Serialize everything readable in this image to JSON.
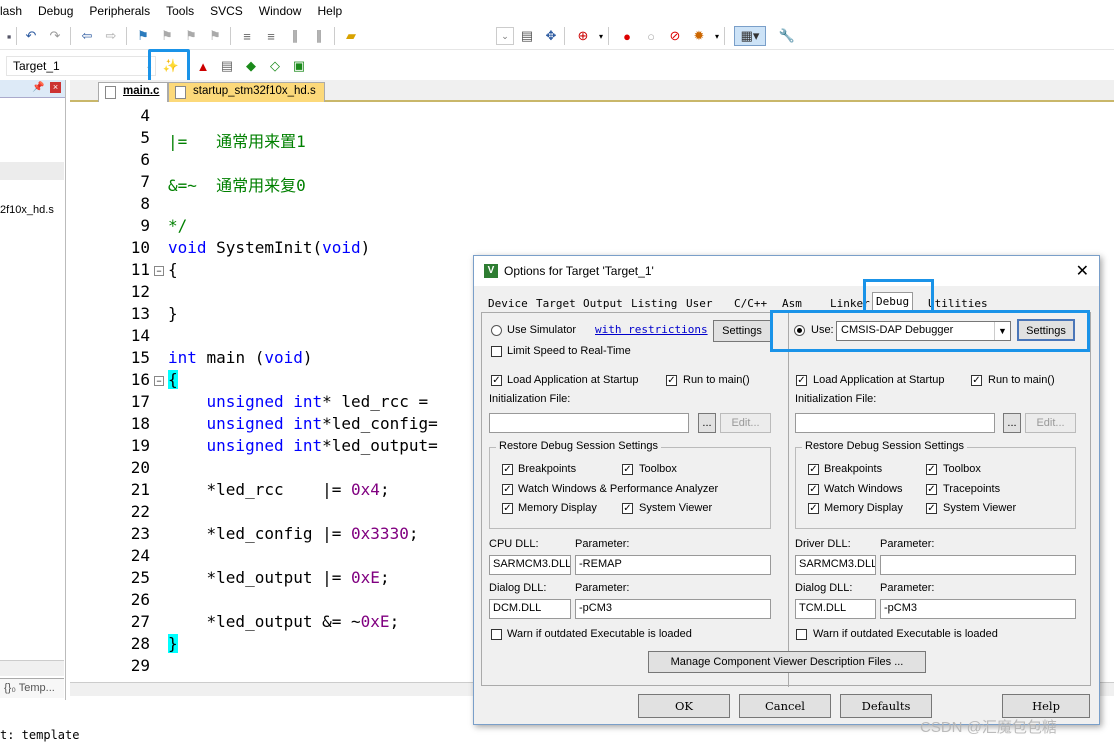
{
  "menu": [
    "lash",
    "Debug",
    "Peripherals",
    "Tools",
    "SVCS",
    "Window",
    "Help"
  ],
  "toolbar": {
    "target": "Target_1"
  },
  "left_panel": {
    "items": [
      "2f10x_hd.s"
    ],
    "bottom_tab": "{}₀ Temp..."
  },
  "tabs": [
    {
      "label": "main.c"
    },
    {
      "label": "startup_stm32f10x_hd.s"
    }
  ],
  "code": {
    "lines": [
      "4",
      "5",
      "6",
      "7",
      "8",
      "9",
      "10",
      "11",
      "12",
      "13",
      "14",
      "15",
      "16",
      "17",
      "18",
      "19",
      "20",
      "21",
      "22",
      "23",
      "24",
      "25",
      "26",
      "27",
      "28",
      "29"
    ],
    "c5": "|=   通常用来置1",
    "c7": "&=~  通常用来复0",
    "c9": "*/",
    "c10_kw1": "void",
    "c10_mid": " SystemInit(",
    "c10_kw2": "void",
    "c10_end": ")",
    "c11": "{",
    "c13": "}",
    "c15_kw1": "int",
    "c15_mid": " main (",
    "c15_kw2": "void",
    "c15_end": ")",
    "c16": "{",
    "c17_a": "    ",
    "c17_kw1": "unsigned",
    "c17_sp": " ",
    "c17_kw2": "int",
    "c17_rest": "* led_rcc =",
    "c18_a": "    ",
    "c18_kw1": "unsigned",
    "c18_sp": " ",
    "c18_kw2": "int",
    "c18_rest": "*led_config=",
    "c19_a": "    ",
    "c19_kw1": "unsigned",
    "c19_sp": " ",
    "c19_kw2": "int",
    "c19_rest": "*led_output=",
    "c21_a": "    *led_rcc    |= ",
    "c21_n": "0x4",
    "c21_e": ";",
    "c23_a": "    *led_config |= ",
    "c23_n": "0x3330",
    "c23_e": ";",
    "c25_a": "    *led_output |= ",
    "c25_n": "0xE",
    "c25_e": ";",
    "c27_a": "    *led_output &= ~",
    "c27_n": "0xE",
    "c27_e": ";",
    "c28": "}"
  },
  "status": "t: template",
  "dialog": {
    "title": "Options for Target 'Target_1'",
    "tabs": [
      "Device",
      "Target",
      "Output",
      "Listing",
      "User",
      "C/C++",
      "Asm",
      "Linker",
      "Debug",
      "Utilities"
    ],
    "left": {
      "use_simulator": "Use Simulator",
      "with_restrictions": "with restrictions",
      "settings": "Settings",
      "limit_speed": "Limit Speed to Real-Time",
      "load_app": "Load Application at Startup",
      "run_to_main": "Run to main()",
      "init_file": "Initialization File:",
      "dots": "...",
      "edit": "Edit...",
      "restore_group": "Restore Debug Session Settings",
      "breakpoints": "Breakpoints",
      "toolbox": "Toolbox",
      "watch": "Watch Windows & Performance Analyzer",
      "memory": "Memory Display",
      "system_viewer": "System Viewer",
      "cpu_dll": "CPU DLL:",
      "parameter": "Parameter:",
      "cpu_dll_val": "SARMCM3.DLL",
      "cpu_param_val": "-REMAP",
      "dialog_dll": "Dialog DLL:",
      "dialog_dll_val": "DCM.DLL",
      "dialog_param_val": "-pCM3",
      "warn": "Warn if outdated Executable is loaded"
    },
    "right": {
      "use": "Use:",
      "debugger": "CMSIS-DAP Debugger",
      "settings": "Settings",
      "load_app": "Load Application at Startup",
      "run_to_main": "Run to main()",
      "init_file": "Initialization File:",
      "dots": "...",
      "edit": "Edit...",
      "restore_group": "Restore Debug Session Settings",
      "breakpoints": "Breakpoints",
      "toolbox": "Toolbox",
      "watch": "Watch Windows",
      "tracepoints": "Tracepoints",
      "memory": "Memory Display",
      "system_viewer": "System Viewer",
      "driver_dll": "Driver DLL:",
      "parameter": "Parameter:",
      "driver_dll_val": "SARMCM3.DLL",
      "dialog_dll": "Dialog DLL:",
      "dialog_dll_val": "TCM.DLL",
      "dialog_param_val": "-pCM3",
      "warn": "Warn if outdated Executable is loaded"
    },
    "manage": "Manage Component Viewer Description Files ...",
    "buttons": {
      "ok": "OK",
      "cancel": "Cancel",
      "defaults": "Defaults",
      "help": "Help"
    }
  },
  "watermark": "CSDN @汇魔包包糖",
  "colors": {
    "highlight": "#1a93e8",
    "keyword": "#0000ff",
    "comment": "#008000",
    "number": "#800080"
  }
}
